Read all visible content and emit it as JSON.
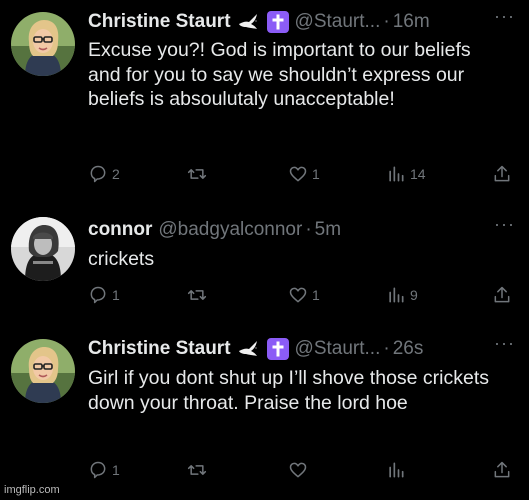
{
  "tweets": [
    {
      "name": "Christine Staurt",
      "handle": "@Staurt...",
      "time": "16m",
      "text": "Excuse you?! God is important to our beliefs and for you to say we shouldn’t express our beliefs is absoulutaly unacceptable!",
      "badges": [
        "dove-icon",
        "cross-icon"
      ],
      "replies": "2",
      "retweets": "",
      "likes": "1",
      "views": "14"
    },
    {
      "name": "connor",
      "handle": "@badgyalconnor",
      "time": "5m",
      "text": "crickets",
      "badges": [],
      "replies": "1",
      "retweets": "",
      "likes": "1",
      "views": "9"
    },
    {
      "name": "Christine Staurt",
      "handle": "@Staurt...",
      "time": "26s",
      "text": "Girl if you dont shut up I’ll shove those crickets down your throat. Praise the lord hoe",
      "badges": [
        "dove-icon",
        "cross-icon"
      ],
      "replies": "1",
      "retweets": "",
      "likes": "",
      "views": ""
    }
  ],
  "separator": "·",
  "more_glyph": "···",
  "watermark": "imgflip.com",
  "colors": {
    "background": "#000000",
    "text": "#e7e9ea",
    "muted": "#71767b",
    "cross_badge": "#8b5cf6"
  }
}
